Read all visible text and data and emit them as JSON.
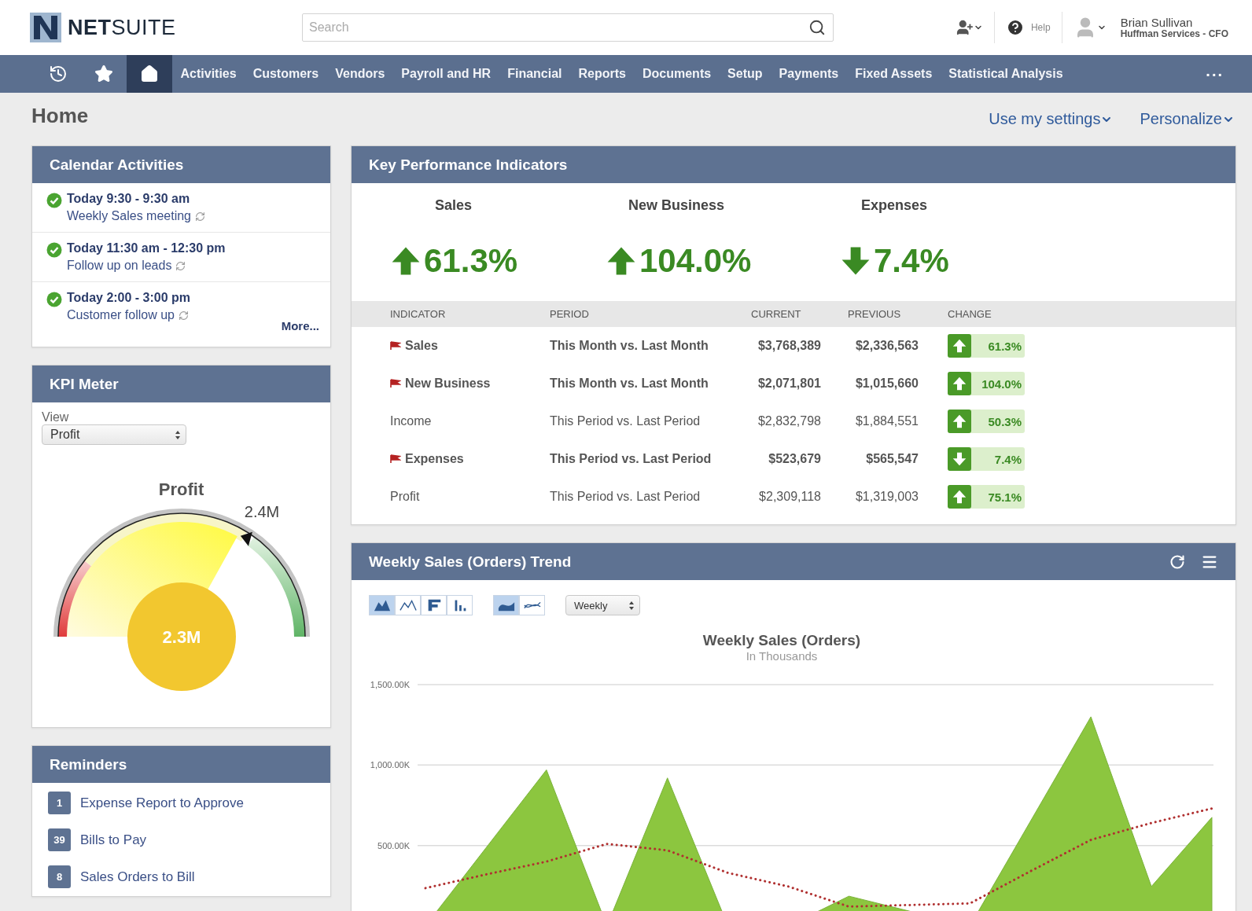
{
  "header": {
    "logo": "**NET**SUITE",
    "search": {
      "placeholder": "Search"
    },
    "help": "Help",
    "user": {
      "name": "Brian Sullivan",
      "role": "Huffman Services - CFO"
    }
  },
  "nav": {
    "icons": [
      {
        "kind": "recent",
        "selected": false
      },
      {
        "kind": "star",
        "selected": false
      },
      {
        "kind": "home",
        "selected": true
      }
    ],
    "items": [
      {
        "label": "Activities",
        "selected": false
      },
      {
        "label": "Customers",
        "selected": false
      },
      {
        "label": "Vendors",
        "selected": false
      },
      {
        "label": "Payroll and HR",
        "selected": false
      },
      {
        "label": "Financial",
        "selected": false
      },
      {
        "label": "Reports",
        "selected": false
      },
      {
        "label": "Documents",
        "selected": false
      },
      {
        "label": "Setup",
        "selected": false
      },
      {
        "label": "Payments",
        "selected": false
      },
      {
        "label": "Fixed Assets",
        "selected": false
      },
      {
        "label": "Statistical Analysis",
        "selected": false
      }
    ],
    "more": "..."
  },
  "page": {
    "title": "Home",
    "links": [
      "Use my settings",
      "Personalize"
    ]
  },
  "calendar": {
    "title": "Calendar Activities",
    "events": [
      {
        "time": "Today 9:30 - 9:30 am",
        "title": "Weekly Sales meeting",
        "done": true,
        "recurring": true
      },
      {
        "time": "Today 11:30 am - 12:30 pm",
        "title": "Follow up on leads",
        "done": true,
        "recurring": true
      },
      {
        "time": "Today 2:00 - 3:00 pm",
        "title": "Customer follow up",
        "done": true,
        "recurring": true
      }
    ],
    "more": "More..."
  },
  "kpi_meter": {
    "title": "KPI Meter",
    "view_label": "View",
    "view_value": "Profit",
    "gauge": {
      "title": "Profit",
      "target": "2.4M",
      "value": "2.3M"
    }
  },
  "reminders": {
    "title": "Reminders",
    "items": [
      {
        "count": "1",
        "label": "Expense Report to Approve"
      },
      {
        "count": "39",
        "label": "Bills to Pay"
      },
      {
        "count": "8",
        "label": "Sales Orders to Bill"
      }
    ]
  },
  "kpi": {
    "title": "Key Performance Indicators",
    "highlights": [
      {
        "label": "Sales",
        "value": "61.3%",
        "rising": true
      },
      {
        "label": "New Business",
        "value": "104.0%",
        "rising": true
      },
      {
        "label": "Expenses",
        "value": "7.4%",
        "rising": false
      }
    ],
    "columns": [
      "INDICATOR",
      "PERIOD",
      "CURRENT",
      "PREVIOUS",
      "CHANGE"
    ],
    "rows": [
      {
        "indicator": "Sales",
        "flagged": true,
        "period": "This Month vs. Last Month",
        "current": "$3,768,389",
        "previous": "$2,336,563",
        "change": "61.3%",
        "rising": true
      },
      {
        "indicator": "New Business",
        "flagged": true,
        "period": "This Month vs. Last Month",
        "current": "$2,071,801",
        "previous": "$1,015,660",
        "change": "104.0%",
        "rising": true
      },
      {
        "indicator": "Income",
        "flagged": false,
        "period": "This Period vs. Last Period",
        "current": "$2,832,798",
        "previous": "$1,884,551",
        "change": "50.3%",
        "rising": true
      },
      {
        "indicator": "Expenses",
        "flagged": true,
        "period": "This Period vs. Last Period",
        "current": "$523,679",
        "previous": "$565,547",
        "change": "7.4%",
        "rising": false
      },
      {
        "indicator": "Profit",
        "flagged": false,
        "period": "This Period vs. Last Period",
        "current": "$2,309,118",
        "previous": "$1,319,003",
        "change": "75.1%",
        "rising": true
      }
    ]
  },
  "weekly": {
    "title": "Weekly Sales (Orders) Trend",
    "chart_types": [
      {
        "kind": "area",
        "selected": true
      },
      {
        "kind": "line",
        "selected": false
      },
      {
        "kind": "step",
        "selected": false
      },
      {
        "kind": "column",
        "selected": false
      }
    ],
    "trend_types": [
      {
        "kind": "smooth",
        "selected": true
      },
      {
        "kind": "outline",
        "selected": false
      }
    ],
    "period": "Weekly",
    "subtitle": "In Thousands",
    "chart_data": {
      "type": "area",
      "title": "Weekly Sales (Orders)",
      "categories": [
        null,
        null,
        null,
        null,
        null,
        null,
        null,
        null,
        null,
        null,
        null,
        null,
        null,
        null
      ],
      "ylim": [
        0,
        1500
      ],
      "yticks": [
        {
          "value": 500,
          "label": "500.00K"
        },
        {
          "value": 1000,
          "label": "1,000.00K"
        },
        {
          "value": 1500,
          "label": "1,500.00K"
        }
      ],
      "series": [
        {
          "color": "#8cc63f",
          "values": [
            0,
            485,
            970,
            0,
            920,
            0,
            0,
            185,
            92,
            0,
            650,
            1300,
            245,
            675
          ]
        },
        {
          "type": "line",
          "line_style": "dotted",
          "color": "#b03030",
          "values": [
            235,
            320,
            400,
            510,
            470,
            330,
            245,
            120,
            130,
            140,
            340,
            535,
            640,
            730
          ]
        }
      ]
    }
  }
}
